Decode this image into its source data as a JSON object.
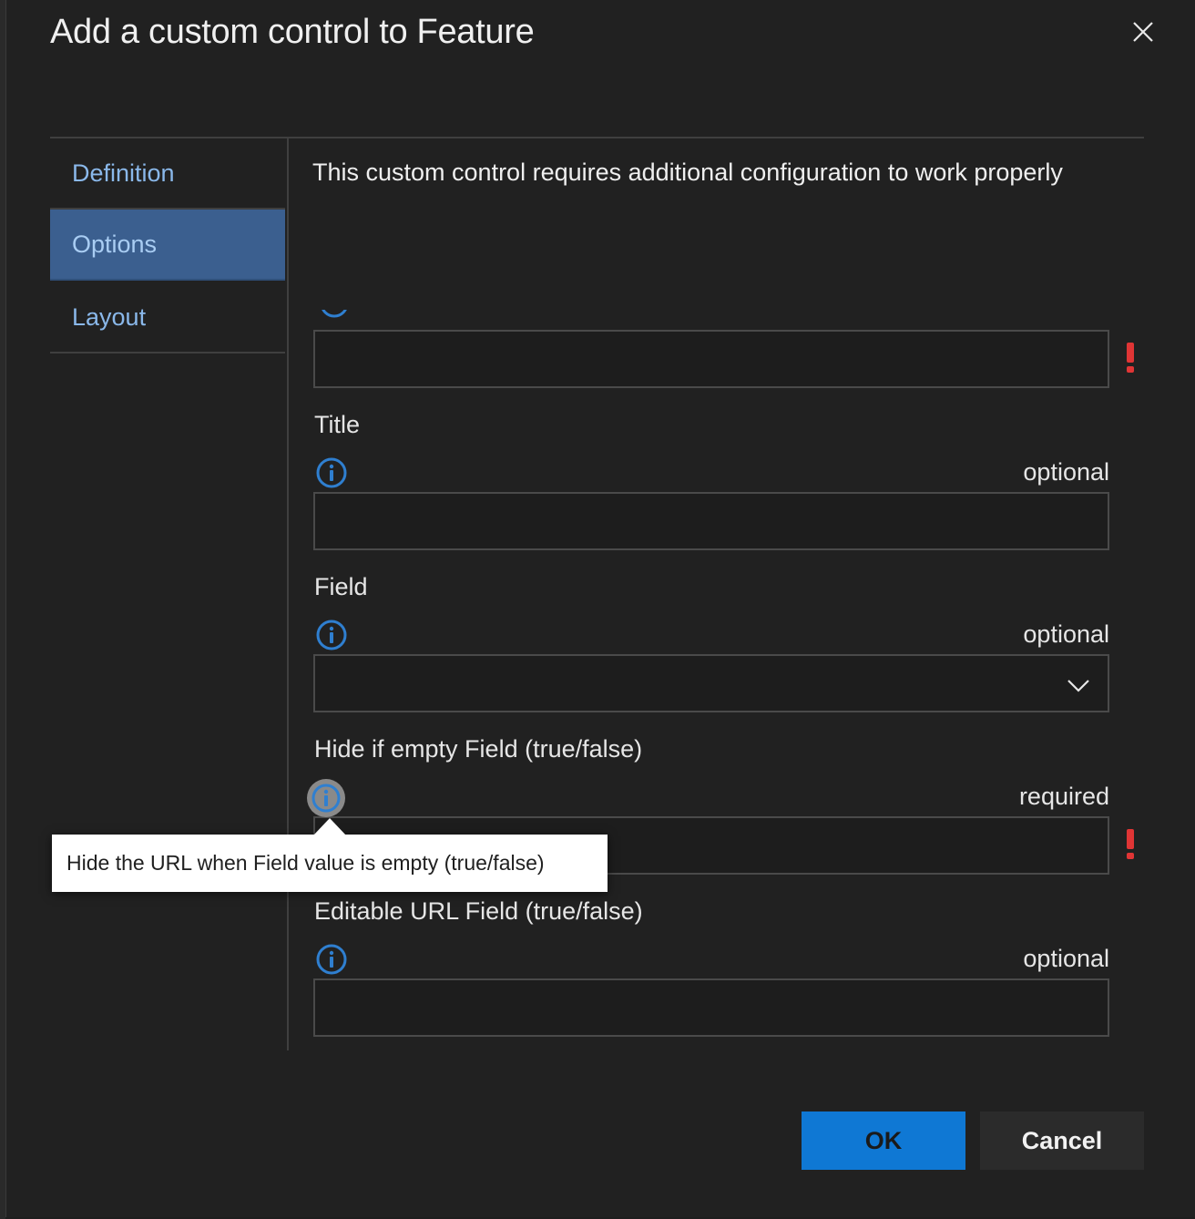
{
  "dialog": {
    "title": "Add a custom control to Feature"
  },
  "tabs": [
    {
      "label": "Definition"
    },
    {
      "label": "Options"
    },
    {
      "label": "Layout"
    }
  ],
  "active_tab": "Options",
  "content": {
    "intro": "This custom control requires additional configuration to work properly",
    "fields": [
      {
        "label": "Title",
        "qualifier": "optional",
        "value": ""
      },
      {
        "label": "Field",
        "qualifier": "optional",
        "value": ""
      },
      {
        "label": "Hide if empty Field (true/false)",
        "qualifier": "required",
        "value": ""
      },
      {
        "label": "Editable URL Field (true/false)",
        "qualifier": "optional",
        "value": ""
      }
    ]
  },
  "tooltip": {
    "text": "Hide the URL when Field value is empty (true/false)"
  },
  "footer": {
    "ok_label": "OK",
    "cancel_label": "Cancel"
  },
  "colors": {
    "accent": "#0f78d4",
    "active_tab": "#3b5f8f",
    "link_text": "#8ab8ea",
    "error": "#e03535",
    "info_icon": "#2f7fd0"
  }
}
